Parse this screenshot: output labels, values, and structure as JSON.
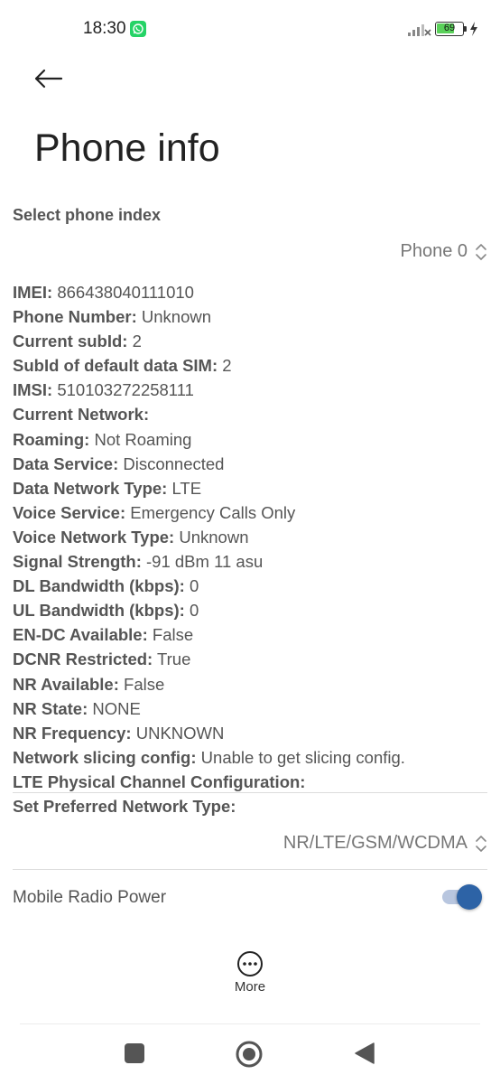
{
  "status_bar": {
    "time": "18:30",
    "notification_icon": "whatsapp-icon",
    "signal_icon": "signal-no-service-icon",
    "battery_level": "69",
    "charging_icon": "charging-bolt-icon"
  },
  "header": {
    "back_icon": "arrow-left-icon",
    "title": "Phone info"
  },
  "phone_index": {
    "label": "Select phone index",
    "selected": "Phone 0"
  },
  "info": [
    {
      "key": "IMEI:",
      "value": "866438040111010"
    },
    {
      "key": "Phone Number:",
      "value": "Unknown"
    },
    {
      "key": "Current subId:",
      "value": "2"
    },
    {
      "key": "SubId of default data SIM:",
      "value": "2"
    },
    {
      "key": "IMSI:",
      "value": "510103272258111"
    },
    {
      "key": "Current Network:",
      "value": ""
    },
    {
      "key": "Roaming:",
      "value": "Not Roaming"
    },
    {
      "key": "Data Service:",
      "value": "Disconnected"
    },
    {
      "key": "Data Network Type:",
      "value": "LTE"
    },
    {
      "key": "Voice Service:",
      "value": "Emergency Calls Only"
    },
    {
      "key": "Voice Network Type:",
      "value": "Unknown"
    },
    {
      "key": "Signal Strength:",
      "value": "-91 dBm   11 asu"
    },
    {
      "key": "DL Bandwidth (kbps):",
      "value": "0"
    },
    {
      "key": "UL Bandwidth (kbps):",
      "value": "0"
    },
    {
      "key": "EN-DC Available:",
      "value": "False"
    },
    {
      "key": "DCNR Restricted:",
      "value": "True"
    },
    {
      "key": "NR Available:",
      "value": "False"
    },
    {
      "key": "NR State:",
      "value": "NONE"
    },
    {
      "key": "NR Frequency:",
      "value": "UNKNOWN"
    },
    {
      "key": "Network slicing config:",
      "value": "Unable to get slicing config."
    },
    {
      "key": "LTE Physical Channel Configuration:",
      "value": ""
    }
  ],
  "preferred_network": {
    "label": "Set Preferred Network Type:",
    "selected": "NR/LTE/GSM/WCDMA"
  },
  "mobile_radio_power": {
    "label": "Mobile Radio Power",
    "enabled": true
  },
  "bottom_action": {
    "icon": "more-horizontal-icon",
    "label": "More"
  },
  "nav_bar": {
    "recents_icon": "square-icon",
    "home_icon": "circle-home-icon",
    "back_icon": "triangle-back-icon"
  },
  "colors": {
    "accent": "#2d63a6",
    "toggle_track": "#b8c6df",
    "battery_fill": "#5ad15a",
    "whatsapp": "#25d366"
  }
}
